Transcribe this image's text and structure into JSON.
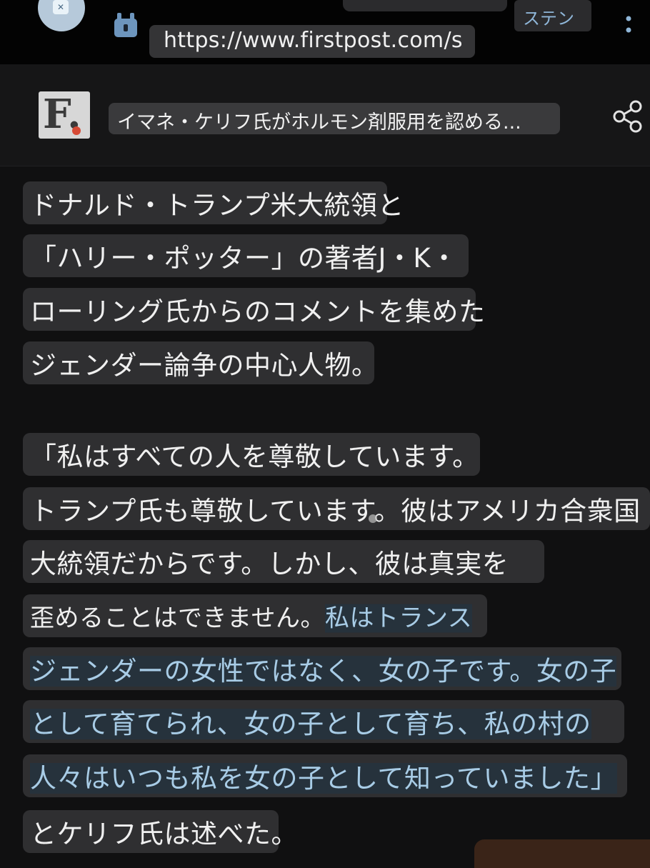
{
  "browser": {
    "url": "https://www.firstpost.com/s",
    "language_chip": "ステン",
    "accent_color": "#8fb6d8"
  },
  "article_header": {
    "site_logo_letter": "F.",
    "title": "イマネ・ケリフ氏がホルモン剤服用を認める..."
  },
  "body_lines": [
    {
      "text": "ドナルド・トランプ米大統領と"
    },
    {
      "text": "「ハリー・ポッター」の著者J・K・"
    },
    {
      "text": "ローリング氏からのコメントを集めた"
    },
    {
      "text": "ジェンダー論争の中心人物。"
    },
    {
      "text": "「私はすべての人を尊敬しています。"
    },
    {
      "text": "トランプ氏も尊敬しています。彼はアメリカ合衆国"
    },
    {
      "text": "大統領だからです。しかし、彼は真実を"
    },
    {
      "text": "歪めることはできません。",
      "highlight": "私はトランス"
    },
    {
      "highlight": "ジェンダーの女性ではなく、女の子です。女の子"
    },
    {
      "highlight": "として育てられ、女の子として育ち、私の村の"
    },
    {
      "highlight": "人々はいつも私を女の子として知っていました」"
    },
    {
      "text": "とケリフ氏は述べた。"
    }
  ]
}
